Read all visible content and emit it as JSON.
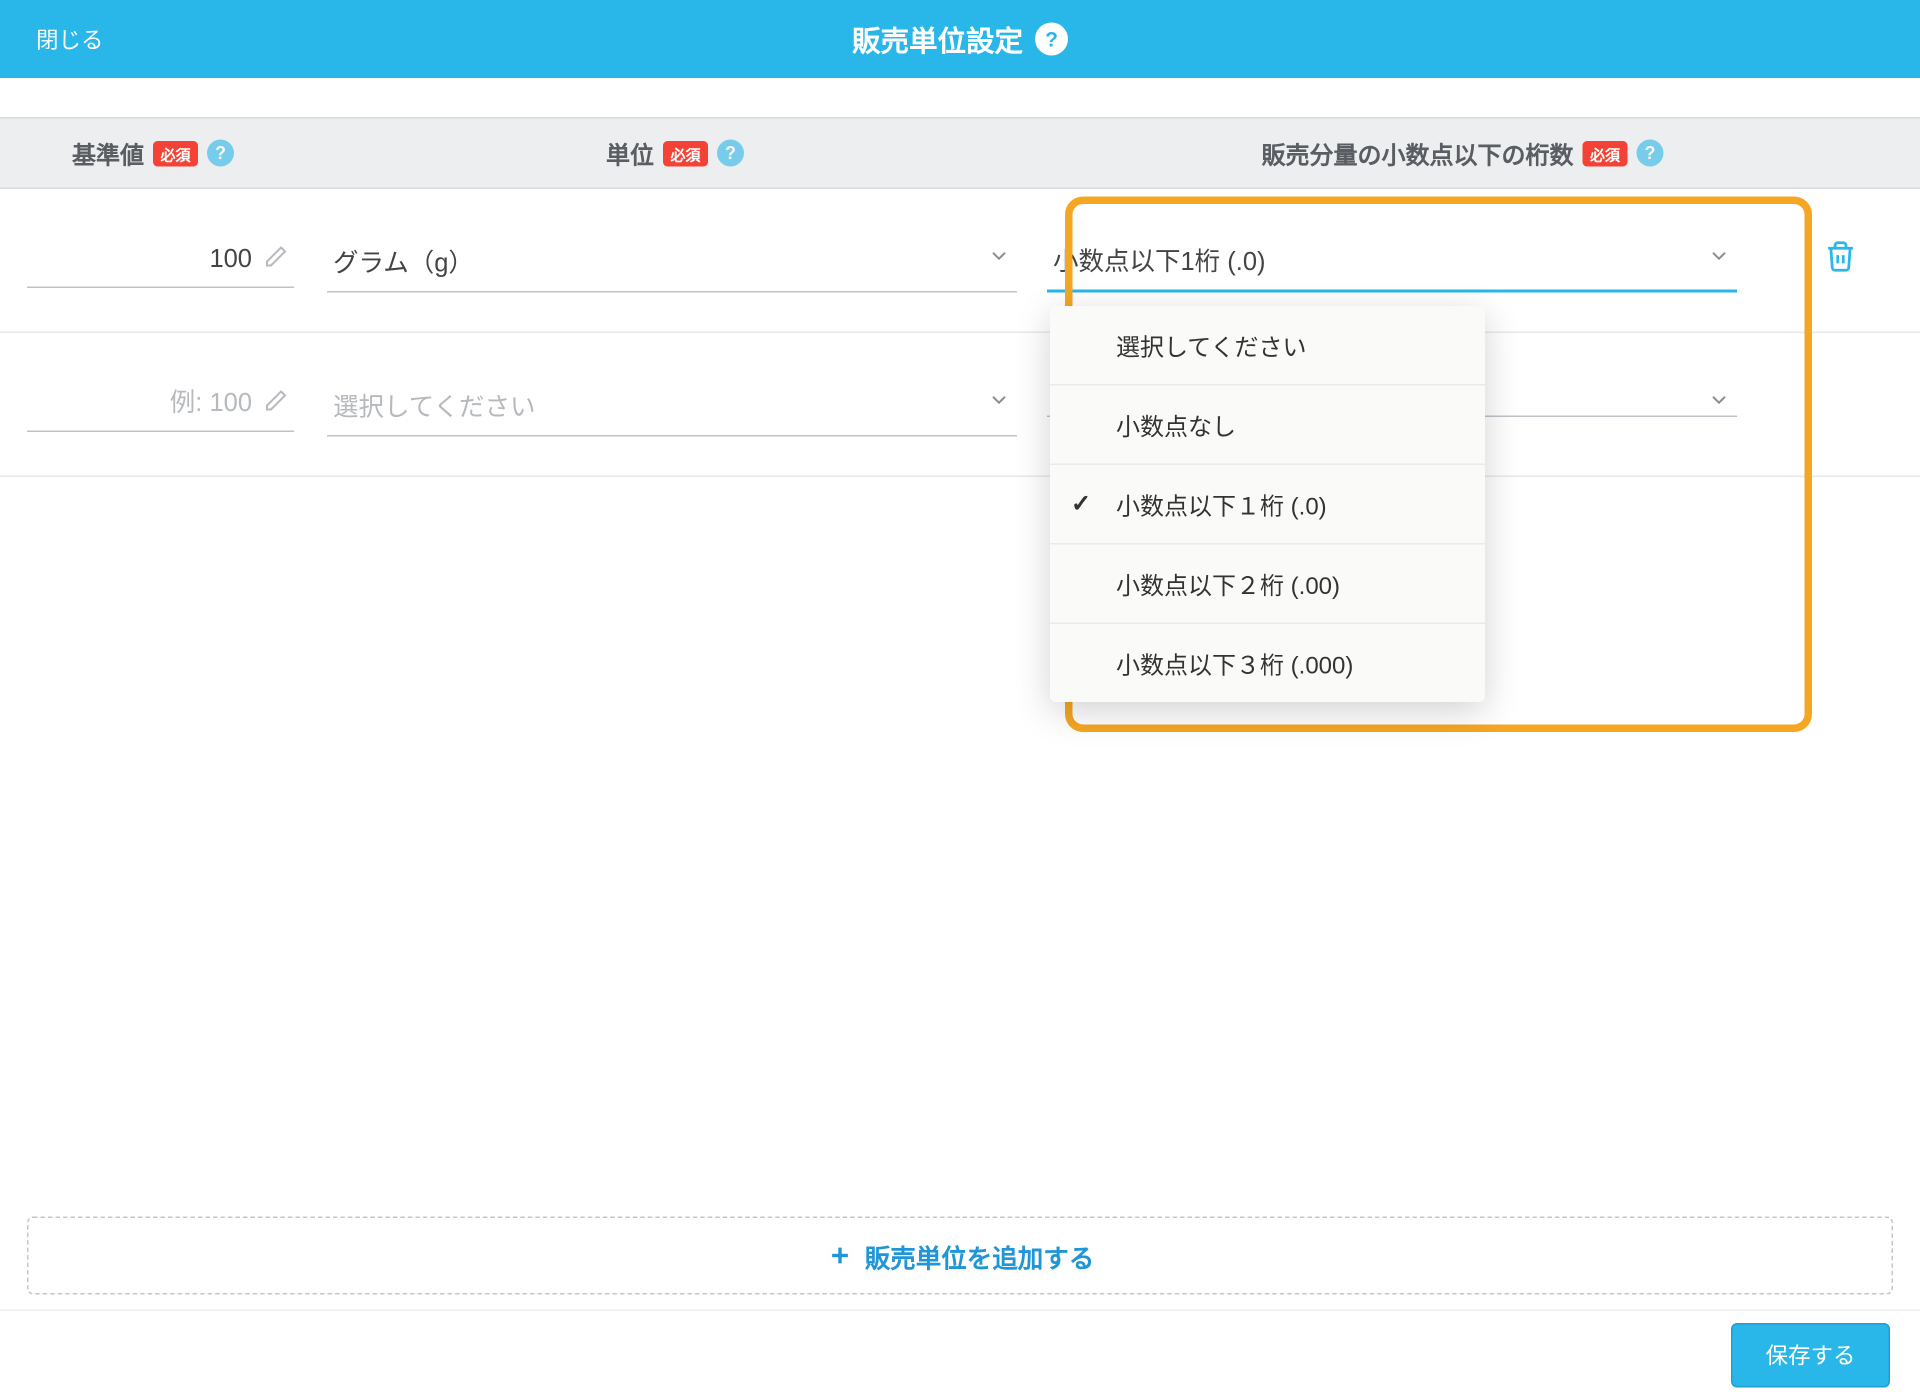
{
  "header": {
    "close": "閉じる",
    "title": "販売単位設定"
  },
  "columns": {
    "base_value": "基準値",
    "unit": "単位",
    "decimals": "販売分量の小数点以下の桁数",
    "required": "必須"
  },
  "rows": [
    {
      "base_value": "100",
      "base_placeholder": "",
      "unit_value": "グラム（g）",
      "unit_placeholder": "",
      "decimals_value": "小数点以下1桁 (.0)",
      "decimals_placeholder": "",
      "decimals_open": true
    },
    {
      "base_value": "",
      "base_placeholder": "例: 100",
      "unit_value": "",
      "unit_placeholder": "選択してください",
      "decimals_value": "",
      "decimals_placeholder": "",
      "decimals_open": false
    }
  ],
  "dropdown_options": [
    {
      "label": "選択してください",
      "checked": false
    },
    {
      "label": "小数点なし",
      "checked": false
    },
    {
      "label": "小数点以下１桁 (.0)",
      "checked": true
    },
    {
      "label": "小数点以下２桁 (.00)",
      "checked": false
    },
    {
      "label": "小数点以下３桁 (.000)",
      "checked": false
    }
  ],
  "footer": {
    "add_label": "販売単位を追加する",
    "save_label": "保存する"
  }
}
